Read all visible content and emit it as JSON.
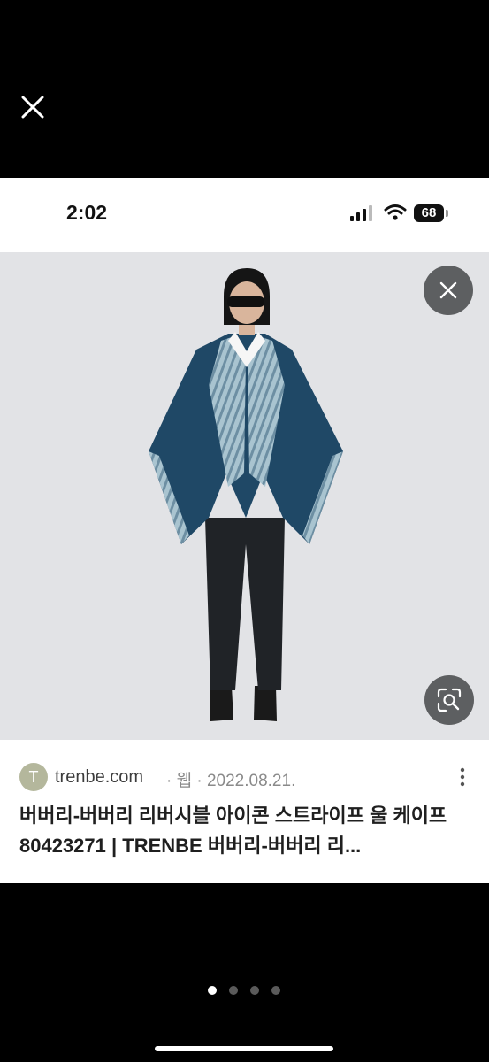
{
  "status_bar": {
    "time": "2:02",
    "battery": "68"
  },
  "image_result": {
    "source_initial": "T",
    "source": "trenbe.com",
    "meta": "· 웹 · 2022.08.21.",
    "title": "버버리-버버리 리버시블 아이콘 스트라이프 울 케이프 80423271 | TRENBE 버버리-버버리 리..."
  },
  "pager": {
    "total": 4,
    "active": 1
  },
  "icons": {
    "viewer_close": "close-icon",
    "image_close": "close-icon",
    "lens": "lens-search-icon",
    "more": "more-vertical-icon",
    "signal": "signal-icon",
    "wifi": "wifi-icon"
  },
  "colors": {
    "page_bg": "#000000",
    "card_bg": "#ffffff",
    "image_bg": "#e2e3e6",
    "overlay_button": "#5d5f61",
    "favicon": "#b4b79c",
    "cape_outer": "#1f4866",
    "cape_inner": "#a9c4d0"
  }
}
